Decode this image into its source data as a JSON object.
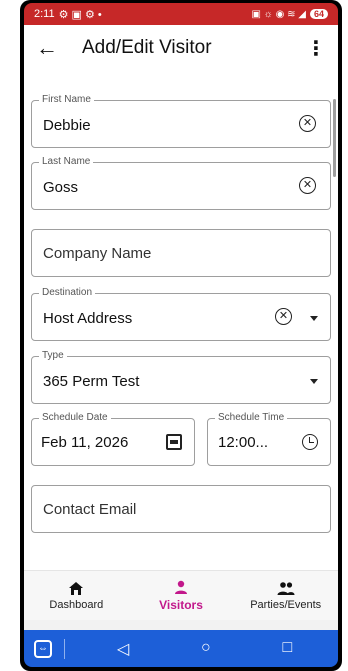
{
  "status_bar": {
    "time": "2:11",
    "left_icons": "⚙ ▣ ⚙ •",
    "right_icons": "▣ ☼ ◉ ≋ ◢",
    "battery": "64"
  },
  "app_bar": {
    "title": "Add/Edit Visitor",
    "back_icon": "←",
    "more_icon": "⋮"
  },
  "form": {
    "first_name": {
      "label": "First Name",
      "value": "Debbie"
    },
    "last_name": {
      "label": "Last Name",
      "value": "Goss"
    },
    "company_name": {
      "placeholder": "Company Name"
    },
    "destination": {
      "label": "Destination",
      "value": "Host Address"
    },
    "type": {
      "label": "Type",
      "value": "365 Perm Test"
    },
    "schedule_date": {
      "label": "Schedule Date",
      "value": "Feb 11, 2026"
    },
    "schedule_time": {
      "label": "Schedule Time",
      "value": "12:00..."
    },
    "contact_email": {
      "placeholder": "Contact Email"
    },
    "clear_icon": "✕"
  },
  "bottom_nav": {
    "items": [
      {
        "label": "Dashboard",
        "icon": "home-icon"
      },
      {
        "label": "Visitors",
        "icon": "person-icon",
        "active": true
      },
      {
        "label": "Parties/Events",
        "icon": "group-icon"
      }
    ],
    "active_color": "#c2188b"
  },
  "system_nav": {
    "recents": "|||",
    "home": "○",
    "back": "<"
  },
  "remote_bar": {
    "left": "⇔",
    "back": "◁",
    "home": "○",
    "recents": "□"
  }
}
